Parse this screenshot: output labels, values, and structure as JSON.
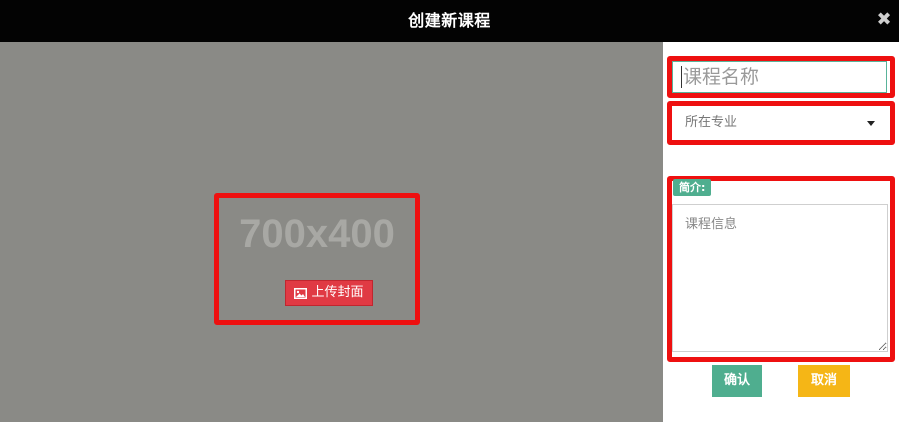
{
  "header": {
    "title": "创建新课程",
    "close_label": "✖"
  },
  "cover": {
    "size_text": "700x400",
    "upload_label": "上传封面",
    "upload_icon": "image-icon"
  },
  "form": {
    "name_placeholder": "课程名称",
    "major_value": "所在专业",
    "intro_label": "简介:",
    "intro_placeholder": "课程信息"
  },
  "actions": {
    "confirm_label": "确认",
    "cancel_label": "取消"
  },
  "colors": {
    "header_bg": "#030303",
    "cover_bg": "#8a8a86",
    "highlight_red": "#ee1010",
    "upload_red": "#e03a44",
    "accent_green": "#4fae8f",
    "cancel_yellow": "#f5b616"
  }
}
